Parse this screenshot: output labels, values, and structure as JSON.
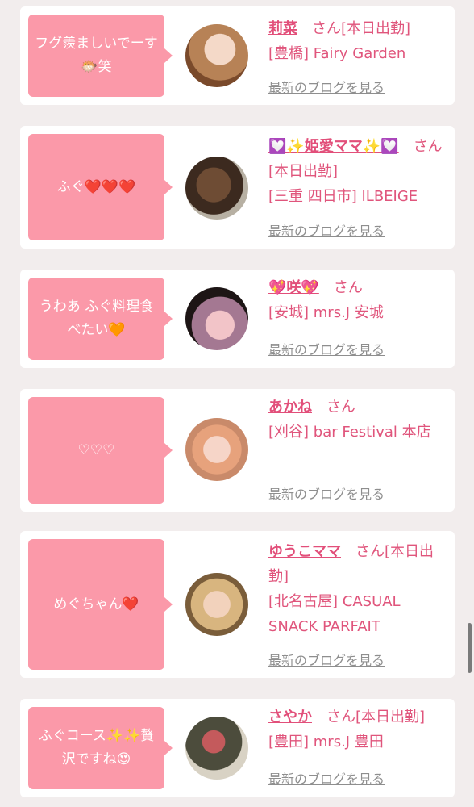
{
  "entries": [
    {
      "comment": "フグ羨ましいでーす🐡笑",
      "name": "莉菜",
      "suffix": "さん[本日出勤]",
      "store": "[豊橋] Fairy Garden",
      "blog_link": "最新のブログを見る"
    },
    {
      "comment": "ふぐ❤️❤️❤️",
      "name": "💟✨姫愛ママ✨💟",
      "suffix": "さん[本日出勤]",
      "store": "[三重 四日市] ILBEIGE",
      "blog_link": "最新のブログを見る"
    },
    {
      "comment": "うわあ ふぐ料理食べたい🧡",
      "name": "💖咲💖",
      "suffix": "さん",
      "store": "[安城] mrs.J 安城",
      "blog_link": "最新のブログを見る"
    },
    {
      "comment": "♡♡♡",
      "name": "あかね",
      "suffix": "さん",
      "store": "[刈谷] bar Festival 本店",
      "blog_link": "最新のブログを見る"
    },
    {
      "comment": "めぐちゃん❤️",
      "name": "ゆうこママ",
      "suffix": "さん[本日出勤]",
      "store": "[北名古屋] CASUAL SNACK PARFAIT",
      "blog_link": "最新のブログを見る"
    },
    {
      "comment": "ふぐコース✨✨贅沢ですね😍",
      "name": "さやか",
      "suffix": "さん[本日出勤]",
      "store": "[豊田] mrs.J 豊田",
      "blog_link": "最新のブログを見る"
    }
  ],
  "colors": {
    "bubble": "#fb99a9",
    "accent": "#e0557c",
    "background": "#f2eded"
  }
}
